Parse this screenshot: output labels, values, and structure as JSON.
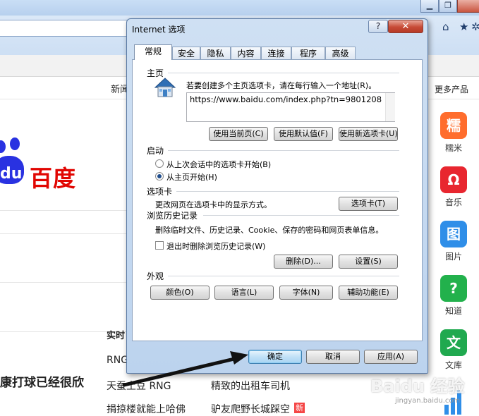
{
  "dialog": {
    "title": "Internet 选项",
    "help_glyph": "?",
    "close_glyph": "✕",
    "tabs": [
      "常规",
      "安全",
      "隐私",
      "内容",
      "连接",
      "程序",
      "高级"
    ],
    "homepage": {
      "heading": "主页",
      "description": "若要创建多个主页选项卡，请在每行输入一个地址(R)。",
      "url": "https://www.baidu.com/index.php?tn=9801208",
      "buttons": [
        "使用当前页(C)",
        "使用默认值(F)",
        "使用新选项卡(U)"
      ]
    },
    "startup": {
      "heading": "启动",
      "options": [
        {
          "label": "从上次会话中的选项卡开始(B)",
          "checked": false
        },
        {
          "label": "从主页开始(H)",
          "checked": true
        }
      ]
    },
    "tabs_section": {
      "heading": "选项卡",
      "description": "更改网页在选项卡中的显示方式。",
      "button": "选项卡(T)"
    },
    "history": {
      "heading": "浏览历史记录",
      "description": "删除临时文件、历史记录、Cookie、保存的密码和网页表单信息。",
      "checkbox_label": "退出时删除浏览历史记录(W)",
      "checkbox_checked": false,
      "delete_button": "删除(D)...",
      "settings_button": "设置(S)"
    },
    "appearance": {
      "heading": "外观",
      "buttons": [
        "颜色(O)",
        "语言(L)",
        "字体(N)",
        "辅助功能(E)"
      ]
    },
    "footer": {
      "ok": "确定",
      "cancel": "取消",
      "apply": "应用(A)"
    }
  },
  "browser": {
    "window_buttons": [
      "▁",
      "❐"
    ],
    "toolbar_icons": [
      "home-icon",
      "star-icon",
      "gear-icon"
    ],
    "nav_partial": "新闻",
    "more_products": "更多产品",
    "logo_text": "百度",
    "logo_du": "du",
    "hot_title": "实时",
    "news_partial": "康打球已经很欣",
    "hot_items": [
      "RNG",
      "天蚕土豆 RNG",
      "精致的出租车司机",
      "捐掠楼就能上哈佛",
      "驴友爬野长城踩空"
    ],
    "new_badge": "新",
    "apps": [
      {
        "label": "糯米",
        "glyph": "糯",
        "color": "#ff6d2d"
      },
      {
        "label": "音乐",
        "glyph": "Ω",
        "color": "#e8262f"
      },
      {
        "label": "图片",
        "glyph": "图",
        "color": "#2f8ee8"
      },
      {
        "label": "知道",
        "glyph": "?",
        "color": "#22b14c"
      },
      {
        "label": "文库",
        "glyph": "文",
        "color": "#20a94f"
      }
    ],
    "watermark": "Baidu 经验",
    "watermark_sub": "jingyan.baidu.com"
  }
}
